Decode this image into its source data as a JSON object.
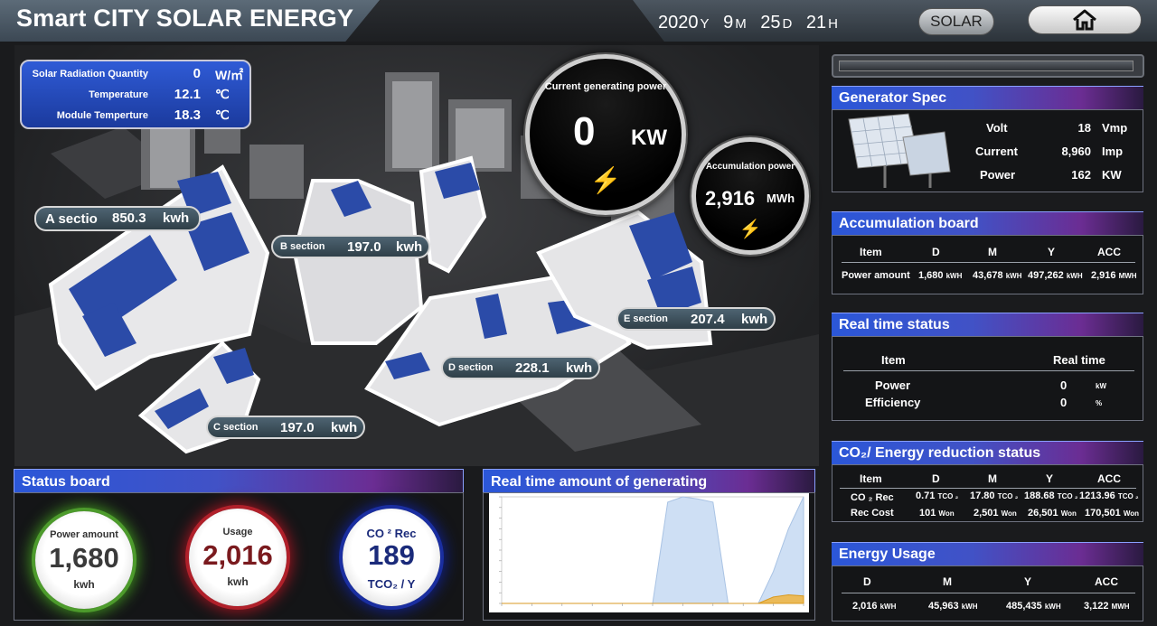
{
  "header": {
    "title": "Smart CITY SOLAR ENERGY",
    "date": {
      "year": "2020",
      "year_unit": "Y",
      "month": "9",
      "month_unit": "M",
      "day": "25",
      "day_unit": "D",
      "hour": "21",
      "hour_unit": "H"
    },
    "solar_button": "SOLAR",
    "home_icon": "home-icon"
  },
  "environment": [
    {
      "label": "Solar Radiation Quantity",
      "value": "0",
      "unit": "W/㎡"
    },
    {
      "label": "Temperature",
      "value": "12.1",
      "unit": "℃"
    },
    {
      "label": "Module Temperture",
      "value": "18.3",
      "unit": "℃"
    }
  ],
  "current_power": {
    "label": "Current generating power",
    "value": "0",
    "unit": "KW"
  },
  "accumulation_power": {
    "label": "Accumulation power",
    "value": "2,916",
    "unit": "MWh"
  },
  "sections": [
    {
      "name": "A sectio",
      "value": "850.3",
      "unit": "kwh"
    },
    {
      "name": "B section",
      "value": "197.0",
      "unit": "kwh"
    },
    {
      "name": "C section",
      "value": "197.0",
      "unit": "kwh"
    },
    {
      "name": "D section",
      "value": "228.1",
      "unit": "kwh"
    },
    {
      "name": "E section",
      "value": "207.4",
      "unit": "kwh"
    }
  ],
  "generator_spec": {
    "title": "Generator Spec",
    "rows": [
      {
        "label": "Volt",
        "value": "18",
        "unit": "Vmp"
      },
      {
        "label": "Current",
        "value": "8,960",
        "unit": "Imp"
      },
      {
        "label": "Power",
        "value": "162",
        "unit": "KW"
      }
    ]
  },
  "accumulation_board": {
    "title": "Accumulation board",
    "headers": [
      "Item",
      "D",
      "M",
      "Y",
      "ACC"
    ],
    "row_label": "Power amount",
    "values": [
      "1,680",
      "43,678",
      "497,262",
      "2,916"
    ],
    "units": [
      "kWH",
      "kWH",
      "kWH",
      "MWH"
    ]
  },
  "realtime_status": {
    "title": "Real time status",
    "headers": [
      "Item",
      "Real time"
    ],
    "rows": [
      {
        "label": "Power",
        "value": "0",
        "unit": "kW"
      },
      {
        "label": "Efficiency",
        "value": "0",
        "unit": "%"
      }
    ]
  },
  "co2_status": {
    "title": "CO₂/ Energy reduction status",
    "headers": [
      "Item",
      "D",
      "M",
      "Y",
      "ACC"
    ],
    "rows": [
      {
        "label": "CO ₂  Rec",
        "values": [
          "0.71",
          "17.80",
          "188.68",
          "1213.96"
        ],
        "unit": "TCO ₂"
      },
      {
        "label": "Rec Cost",
        "values": [
          "101",
          "2,501",
          "26,501",
          "170,501"
        ],
        "unit": "Won"
      }
    ]
  },
  "energy_usage": {
    "title": "Energy Usage",
    "headers": [
      "D",
      "M",
      "Y",
      "ACC"
    ],
    "values": [
      "2,016",
      "45,963",
      "485,435",
      "3,122"
    ],
    "units": [
      "kWH",
      "kWH",
      "kWH",
      "MWH"
    ]
  },
  "status_board": {
    "title": "Status board",
    "power": {
      "label": "Power amount",
      "value": "1,680",
      "unit": "kwh"
    },
    "usage": {
      "label": "Usage",
      "value": "2,016",
      "unit": "kwh"
    },
    "co2": {
      "label": "CO ² Rec",
      "value": "189",
      "unit": "TCO₂ / Y"
    }
  },
  "realtime_chart": {
    "title": "Real time amount of generating"
  },
  "chart_data": {
    "type": "area",
    "title": "",
    "xlabel": "",
    "ylabel": "",
    "x": [
      0,
      1,
      2,
      3,
      4,
      5,
      6,
      7,
      8,
      9,
      10,
      11,
      12,
      13,
      14,
      15,
      16,
      17,
      18,
      19,
      20
    ],
    "series": [
      {
        "values": [
          0,
          0,
          0,
          0,
          0,
          0,
          0,
          0,
          0,
          0,
          0,
          95,
          100,
          98,
          95,
          0,
          0,
          0,
          30,
          70,
          100
        ]
      },
      {
        "values": [
          0,
          0,
          0,
          0,
          0,
          0,
          0,
          0,
          0,
          0,
          0,
          0,
          0,
          0,
          0,
          0,
          0,
          0,
          6,
          8,
          7
        ]
      }
    ],
    "ylim": [
      0,
      100
    ],
    "colors": [
      "#c9dcf3",
      "#f0b43c"
    ],
    "grid": false
  }
}
